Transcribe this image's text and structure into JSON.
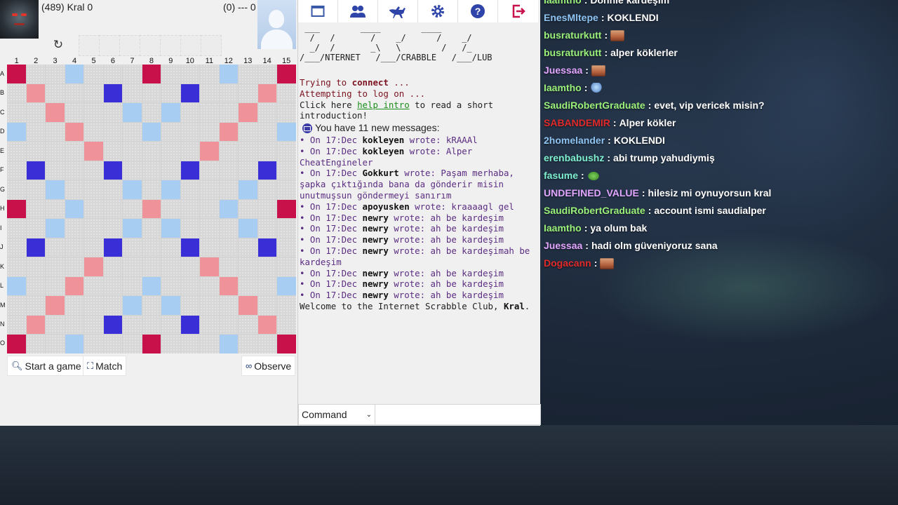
{
  "colors": {
    "triple_word": "#c8104a",
    "double_word": "#f0929a",
    "triple_letter": "#3a2fd6",
    "double_letter": "#a8cdf2",
    "console_maroon": "#7b1220",
    "console_purple": "#5b2d82",
    "link_green": "#1b8f1b",
    "chat_green": "#9bf07a",
    "chat_blue": "#8fc4f2",
    "chat_pink": "#e3a6ff",
    "chat_red": "#e02a2a",
    "chat_teal": "#7ff0d0"
  },
  "players": {
    "self": {
      "label": "(489) Kral 0"
    },
    "opponent": {
      "label": "(0) --- 0"
    }
  },
  "icons": {
    "refresh": "refresh-icon",
    "start": "magnifier-icon",
    "match": "match-icon",
    "observe": "binoculars-icon"
  },
  "board": {
    "columns": [
      "1",
      "2",
      "3",
      "4",
      "5",
      "6",
      "7",
      "8",
      "9",
      "10",
      "11",
      "12",
      "13",
      "14",
      "15"
    ],
    "rows": [
      "A",
      "B",
      "C",
      "D",
      "E",
      "F",
      "G",
      "H",
      "I",
      "J",
      "K",
      "L",
      "M",
      "N",
      "O"
    ],
    "layout": [
      "T..d...T...d..T",
      ".D...t...t...D.",
      "..D...d.d...D..",
      "d..D...d...D..d",
      "....D.....D....",
      ".t...t...t...t.",
      "..d...d.d...d..",
      "T..d...D...d..T",
      "..d...d.d...d..",
      ".t...t...t...t.",
      "....D.....D....",
      "d..D...d...D..d",
      "..D...d.d...D..",
      ".D...t...t...D.",
      "T..d...T...d..T"
    ]
  },
  "buttons": {
    "start_game": "Start a game",
    "match": "Match",
    "observe": "Observe"
  },
  "toolbar": [
    {
      "name": "window-icon"
    },
    {
      "name": "users-icon"
    },
    {
      "name": "horse-icon"
    },
    {
      "name": "gear-icon"
    },
    {
      "name": "help-icon"
    },
    {
      "name": "logout-icon"
    }
  ],
  "console": {
    "logo": " ___        ____        ____\n  /   /       /    _/      /    _/\n  _/  /       _\\   \\        /   /_\n/___/NTERNET   /___/CRABBLE   /___/LUB",
    "trying": "Trying to ",
    "connect": "connect",
    "trying_end": " ...",
    "attempting": "Attempting to log on ...",
    "click_here": "Click here ",
    "help_link": "help intro",
    "click_rest": " to read a short introduction!",
    "new_messages": "You have 11 new messages:",
    "messages": [
      {
        "prefix": "• On 17:Dec ",
        "user": "kokleyen",
        "text": " wrote: kRAAAl"
      },
      {
        "prefix": "• On 17:Dec ",
        "user": "kokleyen",
        "text": " wrote: Alper CheatEngineler"
      },
      {
        "prefix": "• On 17:Dec ",
        "user": "Gokkurt",
        "text": " wrote: Paşam merhaba, şapka çıktığında bana da gönderir misin unutmuşsun göndermeyi sanırım"
      },
      {
        "prefix": "• On 17:Dec ",
        "user": "apoyusken",
        "text": " wrote: kraaaagl gel"
      },
      {
        "prefix": "• On 17:Dec ",
        "user": "newry",
        "text": " wrote: ah be kardeşim"
      },
      {
        "prefix": "• On 17:Dec ",
        "user": "newry",
        "text": " wrote: ah be kardeşim"
      },
      {
        "prefix": "• On 17:Dec ",
        "user": "newry",
        "text": " wrote: ah be kardeşim"
      },
      {
        "prefix": "• On 17:Dec ",
        "user": "newry",
        "text": " wrote: ah be kardeşimah be kardeşim"
      },
      {
        "prefix": "• On 17:Dec ",
        "user": "newry",
        "text": " wrote: ah be kardeşim"
      },
      {
        "prefix": "• On 17:Dec ",
        "user": "newry",
        "text": " wrote: ah be kardeşim"
      },
      {
        "prefix": "• On 17:Dec ",
        "user": "newry",
        "text": " wrote: ah be kardeşim"
      }
    ],
    "welcome": "Welcome to the Internet Scrabble Club, ",
    "welcome_user": "Kral",
    "welcome_end": ".",
    "command_label": "Command",
    "command_value": ""
  },
  "chat": [
    {
      "user": "Iaamtho",
      "color": "#9bf07a",
      "text": "Dohhle kardeşim"
    },
    {
      "user": "EnesMltepe",
      "color": "#8fc4f2",
      "text": "KOKLENDI"
    },
    {
      "user": "busraturkutt",
      "color": "#9bf07a",
      "emote": "face"
    },
    {
      "user": "busraturkutt",
      "color": "#9bf07a",
      "text": "alper köklerler"
    },
    {
      "user": "Juessaa",
      "color": "#e3a6ff",
      "emote": "face"
    },
    {
      "user": "Iaamtho",
      "color": "#9bf07a",
      "emote": "genie"
    },
    {
      "user": "SaudiRobertGraduate",
      "color": "#9bf07a",
      "text": "evet, vip vericek misin?"
    },
    {
      "user": "SABANDEMIR",
      "color": "#e02a2a",
      "text": "Alper kökler"
    },
    {
      "user": "2homelander",
      "color": "#8fc4f2",
      "text": "KOKLENDI"
    },
    {
      "user": "erenbabushz",
      "color": "#7ff0d0",
      "text": "abi trump yahudiymiş"
    },
    {
      "user": "fasume",
      "color": "#7ff0d0",
      "emote": "pepe"
    },
    {
      "user": "UNDEFINED_VALUE",
      "color": "#e3a6ff",
      "text": "hilesiz mi oynuyorsun kral"
    },
    {
      "user": "SaudiRobertGraduate",
      "color": "#9bf07a",
      "text": "account ismi saudialper"
    },
    {
      "user": "Iaamtho",
      "color": "#9bf07a",
      "text": "ya olum bak"
    },
    {
      "user": "Juessaa",
      "color": "#e3a6ff",
      "text": "hadi olm güveniyoruz sana"
    },
    {
      "user": "Dogacann",
      "color": "#e02a2a",
      "emote": "face"
    }
  ]
}
